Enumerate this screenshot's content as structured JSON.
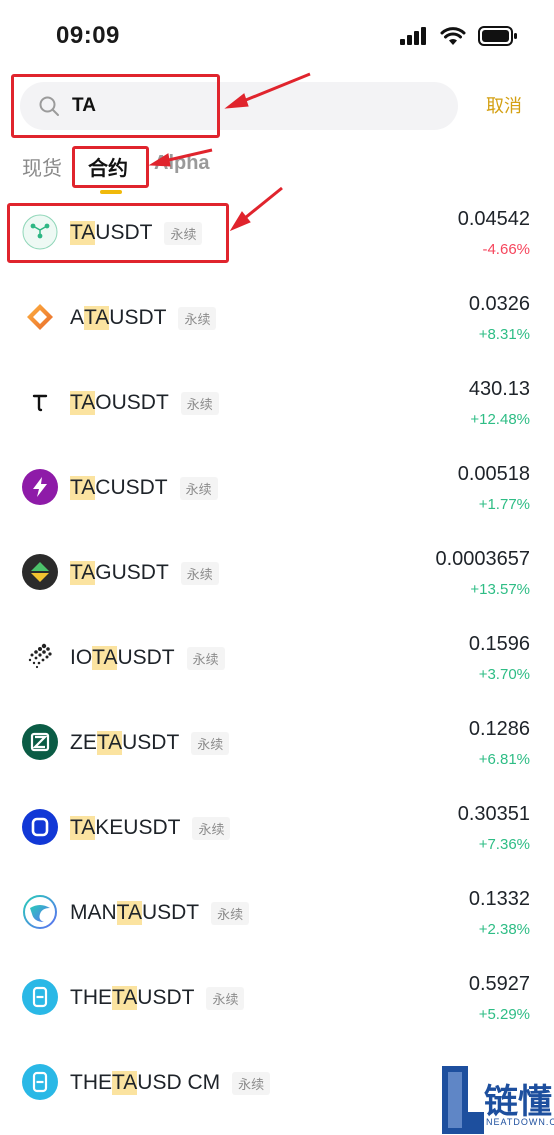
{
  "status_bar": {
    "time": "09:09"
  },
  "search": {
    "query": "TA",
    "cancel_label": "取消"
  },
  "tabs": [
    {
      "label": "现货",
      "active": false
    },
    {
      "label": "合约",
      "active": true
    },
    {
      "label": "Alpha",
      "active": false
    }
  ],
  "colors": {
    "accent": "#f0b90b",
    "cancel": "#d4a013",
    "up": "#2ebd85",
    "down": "#f6465d",
    "annotation": "#e0242d",
    "highlight": "#fbe3a0"
  },
  "tag_label": "永续",
  "rows": [
    {
      "pre": "",
      "hl": "TA",
      "post": "USDT",
      "price": "0.04542",
      "change": "-4.66%",
      "dir": "down",
      "icon": "trusta-logo-icon"
    },
    {
      "pre": "A",
      "hl": "TA",
      "post": "USDT",
      "price": "0.0326",
      "change": "+8.31%",
      "dir": "up",
      "icon": "ata-logo-icon"
    },
    {
      "pre": "",
      "hl": "TA",
      "post": "OUSDT",
      "price": "430.13",
      "change": "+12.48%",
      "dir": "up",
      "icon": "tao-logo-icon"
    },
    {
      "pre": "",
      "hl": "TA",
      "post": "CUSDT",
      "price": "0.00518",
      "change": "+1.77%",
      "dir": "up",
      "icon": "tac-logo-icon"
    },
    {
      "pre": "",
      "hl": "TA",
      "post": "GUSDT",
      "price": "0.0003657",
      "change": "+13.57%",
      "dir": "up",
      "icon": "tag-logo-icon"
    },
    {
      "pre": "IO",
      "hl": "TA",
      "post": "USDT",
      "price": "0.1596",
      "change": "+3.70%",
      "dir": "up",
      "icon": "iota-logo-icon"
    },
    {
      "pre": "ZE",
      "hl": "TA",
      "post": "USDT",
      "price": "0.1286",
      "change": "+6.81%",
      "dir": "up",
      "icon": "zeta-logo-icon"
    },
    {
      "pre": "",
      "hl": "TA",
      "post": "KEUSDT",
      "price": "0.30351",
      "change": "+7.36%",
      "dir": "up",
      "icon": "take-logo-icon"
    },
    {
      "pre": "MAN",
      "hl": "TA",
      "post": "USDT",
      "price": "0.1332",
      "change": "+2.38%",
      "dir": "up",
      "icon": "manta-logo-icon"
    },
    {
      "pre": "THE",
      "hl": "TA",
      "post": "USDT",
      "price": "0.5927",
      "change": "+5.29%",
      "dir": "up",
      "icon": "theta-logo-icon"
    },
    {
      "pre": "THE",
      "hl": "TA",
      "post": "USD CM",
      "price": "",
      "change": "",
      "dir": "up",
      "icon": "theta-logo-icon"
    }
  ],
  "watermark": {
    "text": "链懂",
    "sub": "NEATDOWN.COM"
  }
}
